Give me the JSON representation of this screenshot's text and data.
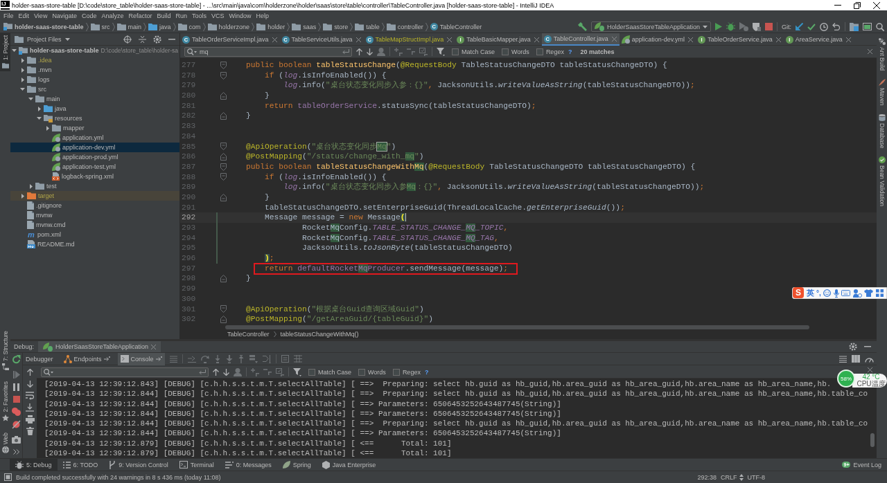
{
  "window": {
    "logo": "IJ",
    "title": "holder-saas-store-table [D:\\code\\store_table\\holder-saas-store-table] - ...\\src\\main\\java\\com\\holderzone\\holder\\saas\\store\\table\\controller\\TableController.java [holder-saas-store-table] - IntelliJ IDEA"
  },
  "menu": [
    "File",
    "Edit",
    "View",
    "Navigate",
    "Code",
    "Analyze",
    "Refactor",
    "Build",
    "Run",
    "Tools",
    "VCS",
    "Window",
    "Help"
  ],
  "navigation_bar": {
    "breadcrumbs": [
      {
        "label": "holder-saas-store-table",
        "kind": "module"
      },
      {
        "label": "src",
        "kind": "folder"
      },
      {
        "label": "main",
        "kind": "folder"
      },
      {
        "label": "java",
        "kind": "source_folder"
      },
      {
        "label": "com",
        "kind": "folder"
      },
      {
        "label": "holderzone",
        "kind": "folder"
      },
      {
        "label": "holder",
        "kind": "folder"
      },
      {
        "label": "saas",
        "kind": "folder"
      },
      {
        "label": "store",
        "kind": "folder"
      },
      {
        "label": "table",
        "kind": "folder"
      },
      {
        "label": "controller",
        "kind": "folder"
      },
      {
        "label": "TableController",
        "kind": "class",
        "icon_letter": "C"
      }
    ],
    "run_configuration": "HolderSaasStoreTableApplication",
    "vcs_label": "Git:"
  },
  "tool_strips": {
    "left_top": [
      {
        "label": "1: Project",
        "kind": "project",
        "selected": true
      }
    ],
    "left_bottom": [
      {
        "label": "7: Structure",
        "kind": "structure",
        "selected": false
      },
      {
        "label": "2: Favorites",
        "kind": "favorites",
        "selected": false
      },
      {
        "label": "Web",
        "kind": "web",
        "selected": false
      }
    ],
    "right": [
      {
        "label": "Ant Build",
        "kind": "ant",
        "selected": false
      },
      {
        "label": "Maven",
        "kind": "maven",
        "selected": false
      },
      {
        "label": "Database",
        "kind": "database",
        "selected": false
      },
      {
        "label": "Bean Validation",
        "kind": "bean_validation",
        "selected": false
      }
    ]
  },
  "project_panel": {
    "title": "Project Files",
    "tree": [
      {
        "label": "holder-saas-store-table",
        "path": "D:\\code\\store_table\\holder-sa",
        "kind": "module",
        "expanded": true,
        "selected": false,
        "ignored": false,
        "children": [
          {
            "label": ".idea",
            "kind": "folder",
            "expanded": false,
            "selected": false,
            "ignored": true
          },
          {
            "label": ".mvn",
            "kind": "folder",
            "expanded": false,
            "selected": false,
            "ignored": false
          },
          {
            "label": "logs",
            "kind": "folder",
            "expanded": false,
            "selected": false,
            "ignored": false
          },
          {
            "label": "src",
            "kind": "folder",
            "expanded": true,
            "selected": false,
            "ignored": false,
            "children": [
              {
                "label": "main",
                "kind": "folder",
                "expanded": true,
                "selected": false,
                "ignored": false,
                "children": [
                  {
                    "label": "java",
                    "kind": "source_folder",
                    "expanded": false,
                    "selected": false,
                    "ignored": false
                  },
                  {
                    "label": "resources",
                    "kind": "resources_folder",
                    "expanded": true,
                    "selected": false,
                    "ignored": false,
                    "children": [
                      {
                        "label": "mapper",
                        "kind": "folder",
                        "expanded": false,
                        "selected": false,
                        "ignored": false
                      },
                      {
                        "label": "application.yml",
                        "kind": "yml",
                        "selected": false,
                        "ignored": false
                      },
                      {
                        "label": "application-dev.yml",
                        "kind": "yml",
                        "selected": true,
                        "ignored": false
                      },
                      {
                        "label": "application-prod.yml",
                        "kind": "yml",
                        "selected": false,
                        "ignored": false
                      },
                      {
                        "label": "application-test.yml",
                        "kind": "yml",
                        "selected": false,
                        "ignored": false
                      },
                      {
                        "label": "logback-spring.xml",
                        "kind": "xml",
                        "selected": false,
                        "ignored": false
                      }
                    ]
                  }
                ]
              },
              {
                "label": "test",
                "kind": "folder",
                "expanded": false,
                "selected": false,
                "ignored": false
              }
            ]
          },
          {
            "label": "target",
            "kind": "excluded_folder",
            "expanded": false,
            "selected": false,
            "ignored": true
          },
          {
            "label": ".gitignore",
            "kind": "file",
            "selected": false,
            "ignored": false
          },
          {
            "label": "mvnw",
            "kind": "file",
            "selected": false,
            "ignored": false
          },
          {
            "label": "mvnw.cmd",
            "kind": "file",
            "selected": false,
            "ignored": false
          },
          {
            "label": "pom.xml",
            "kind": "maven",
            "icon_letter": "m",
            "selected": false,
            "ignored": false
          },
          {
            "label": "README.md",
            "kind": "markdown",
            "selected": false,
            "ignored": false
          }
        ]
      }
    ]
  },
  "editor": {
    "tabs": [
      {
        "label": "TableOrderServiceImpl.java",
        "kind": "class",
        "icon_letter": "C",
        "ignored": false,
        "selected": false
      },
      {
        "label": "TableServiceUtils.java",
        "kind": "class",
        "icon_letter": "C",
        "ignored": false,
        "selected": false
      },
      {
        "label": "TableMapStructImpl.java",
        "kind": "class",
        "icon_letter": "C",
        "ignored": true,
        "selected": false
      },
      {
        "label": "TableBasicMapper.java",
        "kind": "interface",
        "icon_letter": "I",
        "ignored": false,
        "selected": false
      },
      {
        "label": "TableController.java",
        "kind": "class",
        "icon_letter": "C",
        "ignored": false,
        "selected": true
      },
      {
        "label": "application-dev.yml",
        "kind": "yml",
        "ignored": false,
        "selected": false
      },
      {
        "label": "TableOrderService.java",
        "kind": "interface",
        "icon_letter": "I",
        "ignored": false,
        "selected": false
      },
      {
        "label": "AreaService.java",
        "kind": "interface",
        "icon_letter": "I",
        "ignored": false,
        "selected": false
      }
    ],
    "search": {
      "value": "mq",
      "options": [
        {
          "label": "Match Case",
          "checked": false
        },
        {
          "label": "Words",
          "checked": false
        },
        {
          "label": "Regex",
          "checked": false
        }
      ],
      "help": "?",
      "match_count": "20 matches"
    },
    "lines": [
      {
        "number": "277",
        "fold_start": true,
        "tokens": [
          {
            "kind": "keyword",
            "text": "    public boolean "
          },
          {
            "kind": "method",
            "text": "tableStatusChange"
          },
          {
            "kind": "plain",
            "text": "("
          },
          {
            "kind": "annotation",
            "text": "@RequestBody"
          },
          {
            "kind": "plain",
            "text": " TableStatusChangeDTO tableStatusChangeDTO) {"
          }
        ]
      },
      {
        "number": "278",
        "fold_start": true,
        "tokens": [
          {
            "kind": "keyword",
            "text": "        if "
          },
          {
            "kind": "plain",
            "text": "("
          },
          {
            "kind": "static_field",
            "text": "log"
          },
          {
            "kind": "plain",
            "text": ".isInfoEnabled()) {"
          }
        ]
      },
      {
        "number": "279",
        "tokens": [
          {
            "kind": "static_field",
            "text": "            log"
          },
          {
            "kind": "plain",
            "text": ".info("
          },
          {
            "kind": "string",
            "text": "\"桌台状态变化同步入参：{}\""
          },
          {
            "kind": "punctuation",
            "text": ", "
          },
          {
            "kind": "plain",
            "text": "JacksonUtils."
          },
          {
            "kind": "static_call",
            "text": "writeValueAsString"
          },
          {
            "kind": "plain",
            "text": "(tableStatusChangeDTO))"
          },
          {
            "kind": "punctuation",
            "text": ";"
          }
        ]
      },
      {
        "number": "280",
        "fold_end": true,
        "tokens": [
          {
            "kind": "plain",
            "text": "        }"
          }
        ]
      },
      {
        "number": "281",
        "tokens": [
          {
            "kind": "keyword",
            "text": "        return "
          },
          {
            "kind": "field",
            "text": "tableOrderService"
          },
          {
            "kind": "plain",
            "text": ".statusSync(tableStatusChangeDTO)"
          },
          {
            "kind": "punctuation",
            "text": ";"
          }
        ]
      },
      {
        "number": "282",
        "fold_end": true,
        "tokens": [
          {
            "kind": "plain",
            "text": "    }"
          }
        ]
      },
      {
        "number": "283"
      },
      {
        "number": "284"
      },
      {
        "number": "285",
        "fold_start": true,
        "tokens": [
          {
            "kind": "annotation",
            "text": "    @ApiOperation"
          },
          {
            "kind": "plain",
            "text": "("
          },
          {
            "kind": "string",
            "text": "\"桌台状态变化同步"
          },
          {
            "kind": "string",
            "text": "Mq",
            "match": true,
            "focused": true
          },
          {
            "kind": "string",
            "text": "\""
          },
          {
            "kind": "plain",
            "text": ")"
          }
        ]
      },
      {
        "number": "286",
        "fold_end": true,
        "tokens": [
          {
            "kind": "annotation",
            "text": "    @PostMapping"
          },
          {
            "kind": "plain",
            "text": "("
          },
          {
            "kind": "string",
            "text": "\"/status/change_with_"
          },
          {
            "kind": "string",
            "text": "mq",
            "match": true
          },
          {
            "kind": "string",
            "text": "\""
          },
          {
            "kind": "plain",
            "text": ")"
          }
        ]
      },
      {
        "number": "287",
        "fold_start": true,
        "tokens": [
          {
            "kind": "keyword",
            "text": "    public boolean "
          },
          {
            "kind": "method",
            "text": "tableStatusChangeWith"
          },
          {
            "kind": "method",
            "text": "Mq",
            "match": true
          },
          {
            "kind": "plain",
            "text": "("
          },
          {
            "kind": "annotation",
            "text": "@RequestBody"
          },
          {
            "kind": "plain",
            "text": " TableStatusChangeDTO tableStatusChangeDTO) {"
          }
        ]
      },
      {
        "number": "288",
        "fold_start": true,
        "tokens": [
          {
            "kind": "keyword",
            "text": "        if "
          },
          {
            "kind": "plain",
            "text": "("
          },
          {
            "kind": "static_field",
            "text": "log"
          },
          {
            "kind": "plain",
            "text": ".isInfoEnabled()) {"
          }
        ]
      },
      {
        "number": "289",
        "tokens": [
          {
            "kind": "static_field",
            "text": "            log"
          },
          {
            "kind": "plain",
            "text": ".info("
          },
          {
            "kind": "string",
            "text": "\"桌台状态变化同步入参"
          },
          {
            "kind": "string",
            "text": "Mq",
            "match": true
          },
          {
            "kind": "string",
            "text": "：{}\""
          },
          {
            "kind": "punctuation",
            "text": ", "
          },
          {
            "kind": "plain",
            "text": "JacksonUtils."
          },
          {
            "kind": "static_call",
            "text": "writeValueAsString"
          },
          {
            "kind": "plain",
            "text": "(tableStatusChangeDTO))"
          },
          {
            "kind": "punctuation",
            "text": ";"
          }
        ]
      },
      {
        "number": "290",
        "fold_end": true,
        "tokens": [
          {
            "kind": "plain",
            "text": "        }"
          }
        ]
      },
      {
        "number": "291",
        "tokens": [
          {
            "kind": "plain",
            "text": "        tableStatusChangeDTO.setEnterpriseGuid(ThreadLocalCache."
          },
          {
            "kind": "static_call",
            "text": "getEnterpriseGuid"
          },
          {
            "kind": "plain",
            "text": "())"
          },
          {
            "kind": "punctuation",
            "text": ";"
          }
        ]
      },
      {
        "number": "292",
        "current": true,
        "changed": true,
        "tokens": [
          {
            "kind": "plain",
            "text": "        Message message = "
          },
          {
            "kind": "keyword",
            "text": "new "
          },
          {
            "kind": "plain",
            "text": "Message"
          },
          {
            "kind": "plain",
            "text": "(",
            "brace_match": true,
            "caret": true
          }
        ]
      },
      {
        "number": "293",
        "changed": true,
        "tokens": [
          {
            "kind": "plain",
            "text": "                Rocket"
          },
          {
            "kind": "plain",
            "text": "Mq",
            "match": true
          },
          {
            "kind": "plain",
            "text": "Config."
          },
          {
            "kind": "static_field",
            "text": "TABLE_STATUS_CHANGE_"
          },
          {
            "kind": "static_field",
            "text": "MQ",
            "match": true
          },
          {
            "kind": "static_field",
            "text": "_TOPIC"
          },
          {
            "kind": "punctuation",
            "text": ","
          }
        ]
      },
      {
        "number": "294",
        "changed": true,
        "tokens": [
          {
            "kind": "plain",
            "text": "                Rocket"
          },
          {
            "kind": "plain",
            "text": "Mq",
            "match": true
          },
          {
            "kind": "plain",
            "text": "Config."
          },
          {
            "kind": "static_field",
            "text": "TABLE_STATUS_CHANGE_"
          },
          {
            "kind": "static_field",
            "text": "MQ",
            "match": true
          },
          {
            "kind": "static_field",
            "text": "_TAG"
          },
          {
            "kind": "punctuation",
            "text": ","
          }
        ]
      },
      {
        "number": "295",
        "changed": true,
        "tokens": [
          {
            "kind": "plain",
            "text": "                JacksonUtils."
          },
          {
            "kind": "static_call",
            "text": "toJsonByte"
          },
          {
            "kind": "plain",
            "text": "(tableStatusChangeDTO)"
          }
        ]
      },
      {
        "number": "296",
        "changed": true,
        "tokens": [
          {
            "kind": "plain",
            "text": "        )",
            "brace_match": true
          },
          {
            "kind": "punctuation",
            "text": ";"
          }
        ]
      },
      {
        "number": "297",
        "boxed": true,
        "tokens": [
          {
            "kind": "keyword",
            "text": "        return "
          },
          {
            "kind": "field",
            "text": "defaultRocket"
          },
          {
            "kind": "field",
            "text": "Mq",
            "match": true
          },
          {
            "kind": "field",
            "text": "Producer"
          },
          {
            "kind": "plain",
            "text": ".sendMessage(message)"
          },
          {
            "kind": "punctuation",
            "text": ";"
          }
        ]
      },
      {
        "number": "298",
        "fold_end": true,
        "tokens": [
          {
            "kind": "plain",
            "text": "    }"
          }
        ]
      },
      {
        "number": "299"
      },
      {
        "number": "300"
      },
      {
        "number": "301",
        "fold_start": true,
        "tokens": [
          {
            "kind": "annotation",
            "text": "    @ApiOperation"
          },
          {
            "kind": "plain",
            "text": "("
          },
          {
            "kind": "string",
            "text": "\"根据桌台Guid查询区域Guid\""
          },
          {
            "kind": "plain",
            "text": ")"
          }
        ]
      },
      {
        "number": "302",
        "fold_end": true,
        "tokens": [
          {
            "kind": "annotation",
            "text": "    @PostMapping"
          },
          {
            "kind": "plain",
            "text": "("
          },
          {
            "kind": "string",
            "text": "\"/getAreaGuid/{tableGuid}\""
          },
          {
            "kind": "plain",
            "text": ")"
          }
        ]
      }
    ],
    "breadcrumbs": [
      "TableController",
      "tableStatusChangeWithMq()"
    ]
  },
  "debug_panel": {
    "title": "Debug:",
    "session": "HolderSaasStoreTableApplication",
    "tabs": [
      {
        "label": "Debugger",
        "kind": "debugger",
        "selected": false
      },
      {
        "label": "Endpoints",
        "kind": "endpoints",
        "selected": false
      },
      {
        "label": "Console",
        "kind": "console",
        "selected": true
      }
    ],
    "search": {
      "options": [
        {
          "label": "Match Case",
          "checked": false
        },
        {
          "label": "Words",
          "checked": false
        },
        {
          "label": "Regex",
          "checked": false
        }
      ],
      "help": "?"
    },
    "console_lines": [
      "[2019-04-13 12:39:12.843] [DEBUG] [c.h.h.s.s.t.m.T.selectAllTable] [ ==>  Preparing: select hb.guid as hb_guid,hb.area_guid as hb_area_guid,hb.area_name as hb_area_name,hb.",
      "[2019-04-13 12:39:12.844] [DEBUG] [c.h.h.s.s.t.m.T.selectAllTable] [ ==>  Preparing: select hb.guid as hb_guid,hb.area_guid as hb_area_guid,hb.area_name as hb_area_name,hb.table_co",
      "[2019-04-13 12:39:12.844] [DEBUG] [c.h.h.s.s.t.m.T.selectAllTable] [ ==> Parameters: 6506453252643487745(String)]",
      "[2019-04-13 12:39:12.844] [DEBUG] [c.h.h.s.s.t.m.T.selectAllTable] [ ==> Parameters: 6506453252643487745(String)]",
      "[2019-04-13 12:39:12.844] [DEBUG] [c.h.h.s.s.t.m.T.selectAllTable] [ ==>  Preparing: select hb.guid as hb_guid,hb.area_guid as hb_area_guid,hb.area_name as hb_area_name,hb.table_co",
      "[2019-04-13 12:39:12.844] [DEBUG] [c.h.h.s.s.t.m.T.selectAllTable] [ ==> Parameters: 6506453252643487745(String)]",
      "[2019-04-13 12:39:12.879] [DEBUG] [c.h.h.s.s.t.m.T.selectAllTable] [ <==      Total: 101]",
      "[2019-04-13 12:39:12.879] [DEBUG] [c.h.h.s.s.t.m.T.selectAllTable] [ <==      Total: 101]"
    ]
  },
  "tool_window_bar": {
    "items": [
      {
        "label": "5: Debug",
        "kind": "debug",
        "selected": true
      },
      {
        "label": "6: TODO",
        "kind": "todo",
        "selected": false
      },
      {
        "label": "9: Version Control",
        "kind": "version_control",
        "selected": false
      },
      {
        "label": "Terminal",
        "kind": "terminal",
        "selected": false
      },
      {
        "label": "0: Messages",
        "kind": "messages",
        "selected": false
      },
      {
        "label": "Spring",
        "kind": "spring",
        "selected": false
      },
      {
        "label": "Java Enterprise",
        "kind": "java_enterprise",
        "selected": false
      }
    ],
    "event_log": {
      "label": "Event Log",
      "badge": "9+"
    }
  },
  "status_bar": {
    "message": "Build completed successfully with 24 warnings in 8 s 436 ms (today 11:08)",
    "caret_position": "292:38",
    "line_separator": "CRLF",
    "encoding": "UTF-8"
  },
  "input_method_bar": {
    "logo": "S",
    "mode": "英",
    "punctuation": "°,"
  },
  "cpu_monitor": {
    "usage": "58%",
    "temperature": "42 °C",
    "label": "CPU温度"
  }
}
